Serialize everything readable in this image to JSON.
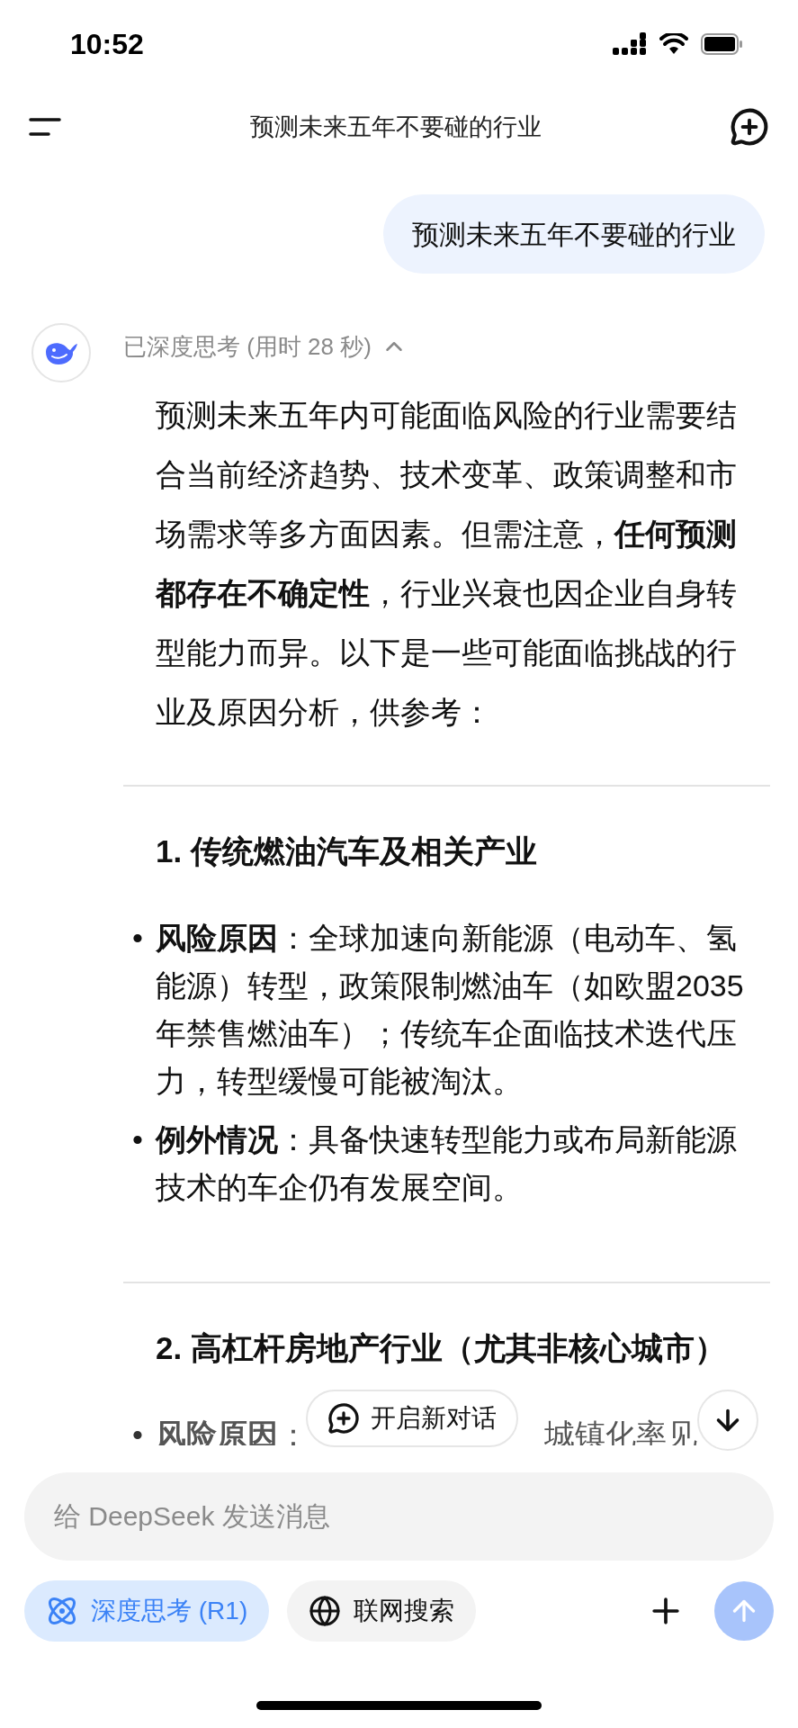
{
  "status_bar": {
    "time": "10:52"
  },
  "header": {
    "title": "预测未来五年不要碰的行业"
  },
  "user_message": {
    "text": "预测未来五年不要碰的行业"
  },
  "reply": {
    "thinking": {
      "label": "已深度思考 (用时 28 秒)",
      "expanded": true
    },
    "intro": "预测未来五年内可能面临风险的行业需要结合当前经济趋势、技术变革、政策调整和市场需求等多方面因素。但需注意，**任何预测都存在不确定性**，行业兴衰也因企业自身转型能力而异。以下是一些可能面临挑战的行业及原因分析，供参考：",
    "sections": [
      {
        "heading": "1. 传统燃油汽车及相关产业",
        "bullets": [
          {
            "marker": "•",
            "text": "**风险原因**：全球加速向新能源（电动车、氢能源）转型，政策限制燃油车（如欧盟2035年禁售燃油车）；传统车企面临技术迭代压力，转型缓慢可能被淘汰。"
          },
          {
            "marker": "•",
            "text": "**例外情况**：具备快速转型能力或布局新能源技术的车企仍有发展空间。"
          }
        ]
      },
      {
        "heading": "2. 高杠杆房地产行业（尤其非核心城市）",
        "bullets": [
          {
            "marker": "•",
            "text": "**风险原因**：",
            "continuation": "城镇化率见"
          }
        ]
      }
    ]
  },
  "new_chat_pill": {
    "label": "开启新对话"
  },
  "composer": {
    "placeholder": "给 DeepSeek 发送消息",
    "toggles": [
      {
        "kind": "deep_think",
        "label": "深度思考 (R1)",
        "selected": true
      },
      {
        "kind": "web_search",
        "label": "联网搜索",
        "selected": false
      }
    ]
  }
}
